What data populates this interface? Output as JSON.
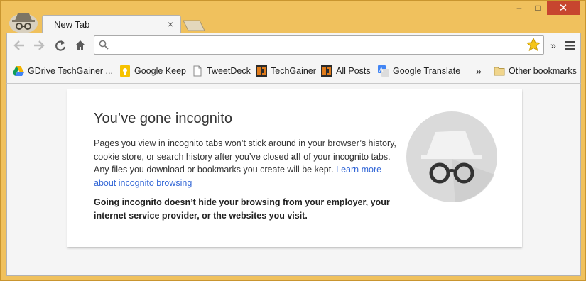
{
  "tab": {
    "title": "New Tab",
    "close": "×"
  },
  "window_controls": {
    "minimize": "–",
    "maximize": "□",
    "close": "✕"
  },
  "omnibox": {
    "value": "",
    "placeholder": ""
  },
  "bookmarks": {
    "items": [
      {
        "label": "GDrive TechGainer ...",
        "icon": "google-drive-icon"
      },
      {
        "label": "Google Keep",
        "icon": "google-keep-icon"
      },
      {
        "label": "TweetDeck",
        "icon": "page-icon"
      },
      {
        "label": "TechGainer",
        "icon": "techgainer-icon"
      },
      {
        "label": "All Posts",
        "icon": "techgainer-icon"
      },
      {
        "label": "Google Translate",
        "icon": "google-translate-icon"
      }
    ],
    "overflow": "»",
    "other": "Other bookmarks"
  },
  "incognito": {
    "title": "You’ve gone incognito",
    "body_part1": "Pages you view in incognito tabs won’t stick around in your browser’s history, cookie store, or search history after you’ve closed ",
    "body_bold": "all",
    "body_part2": " of your incognito tabs. Any files you download or bookmarks you create will be kept. ",
    "learn_more": "Learn more about incognito browsing",
    "warning": "Going incognito doesn’t hide your browsing from your employer, your internet service provider, or the websites you visit."
  },
  "colors": {
    "frame": "#f0c15d",
    "close": "#c7452f",
    "link": "#3367d6"
  }
}
